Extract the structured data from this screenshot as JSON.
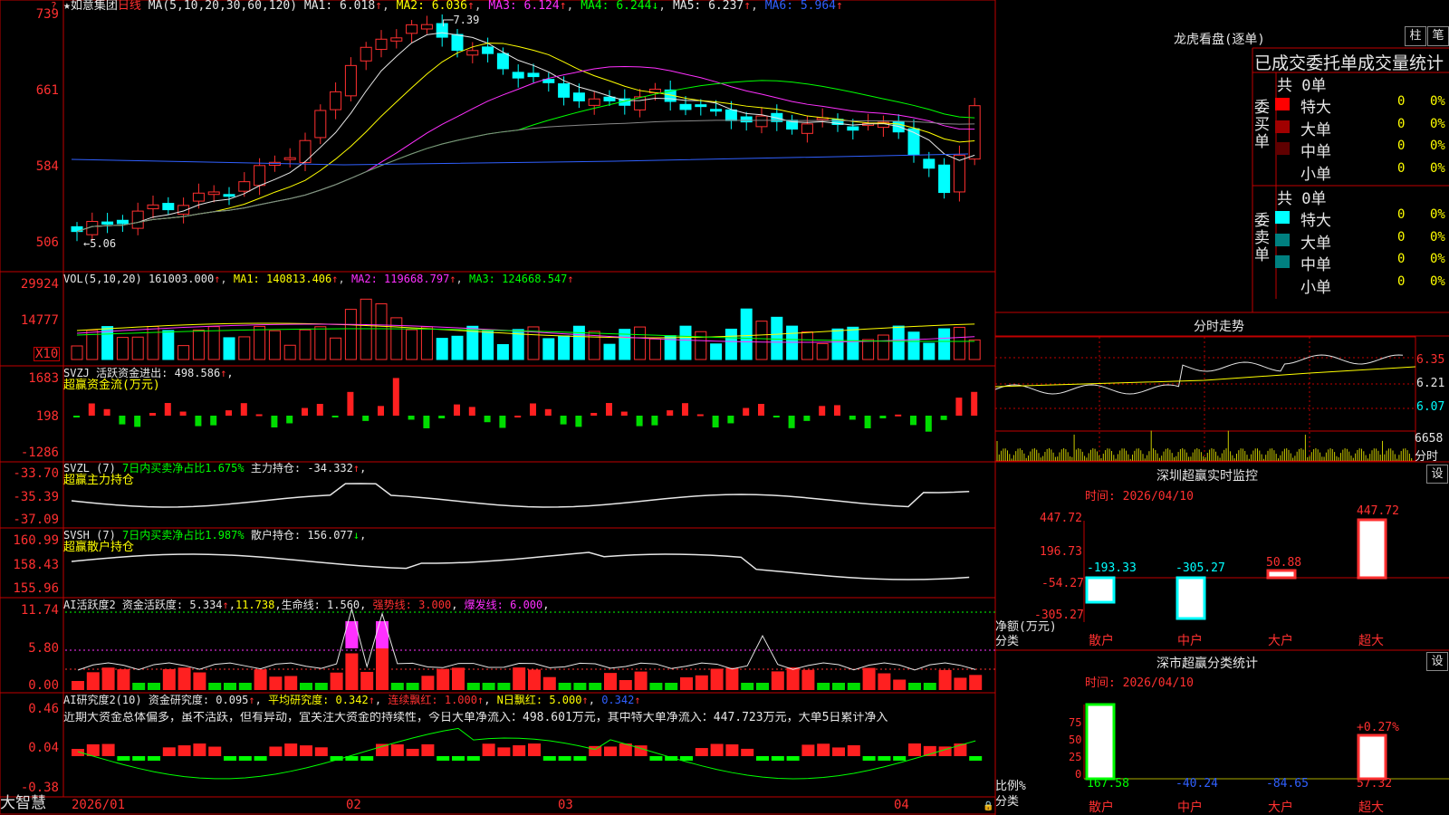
{
  "stock": {
    "star": "★",
    "name": "如意集团",
    "period": "日线"
  },
  "main": {
    "ma_params": "MA(5,10,20,30,60,120)",
    "ma_items": [
      {
        "label": "MA1:",
        "value": "6.018",
        "arrow": "↑",
        "color": "#e6e6e6"
      },
      {
        "label": "MA2:",
        "value": "6.036",
        "arrow": "↑",
        "color": "#ffff00"
      },
      {
        "label": "MA3:",
        "value": "6.124",
        "arrow": "↑",
        "color": "#ff30ff"
      },
      {
        "label": "MA4:",
        "value": "6.244",
        "arrow": "↓",
        "color": "#00ff00"
      },
      {
        "label": "MA5:",
        "value": "6.237",
        "arrow": "↑",
        "color": "#e6e6e6"
      },
      {
        "label": "MA6:",
        "value": "5.964",
        "arrow": "↑",
        "color": "#3060ff"
      }
    ],
    "yticks": [
      "739",
      "661",
      "584",
      "506"
    ],
    "high_label": "7.39",
    "low_label": "5.06",
    "info_icon": "?"
  },
  "vol": {
    "title": "VOL(5,10,20)",
    "value": "161003.000",
    "arrow": "↑",
    "ma1": "MA1: 140813.406",
    "ma1a": "↑",
    "ma2": "MA2: 119668.797",
    "ma2a": "↑",
    "ma3": "MA3: 124668.547",
    "ma3a": "↑",
    "yticks": [
      "29924",
      "14777"
    ],
    "unit": "X10"
  },
  "svzj": {
    "name": "SVZJ",
    "desc": "活跃资金进出:",
    "value": "498.586",
    "arrow": "↑",
    "sep": ",",
    "sub": "超赢资金流(万元)",
    "yticks": [
      "1683",
      "198",
      "-1286"
    ]
  },
  "svzl": {
    "name": "SVZL (7)",
    "desc": "7日内买卖净占比1.675%",
    "desc2": "主力持仓:",
    "value": "-34.332",
    "arrow": "↑",
    "sep": ",",
    "sub": "超赢主力持仓",
    "yticks": [
      "-33.70",
      "-35.39",
      "-37.09"
    ]
  },
  "svsh": {
    "name": "SVSH (7)",
    "desc": "7日内买卖净占比1.987%",
    "desc2": "散户持仓:",
    "value": "156.077",
    "arrow": "↓",
    "sep": ",",
    "sub": "超赢散户持仓",
    "yticks": [
      "160.99",
      "158.43",
      "155.96"
    ]
  },
  "ai1": {
    "name": "AI活跃度2",
    "desc": "资金活跃度:",
    "value": "5.334",
    "a1": "↑",
    "v2": "11.738",
    "lifeline": "生命线: 1.560",
    "strong": "强势线: 3.000",
    "burst": "爆发线: 6.000",
    "sep": ",",
    "yticks": [
      "11.74",
      "5.80",
      "0.00"
    ]
  },
  "ai2": {
    "name": "AI研究度2(10)",
    "desc": "资金研究度:",
    "value": "0.095",
    "a1": "↑",
    "avg": "平均研究度: 0.342",
    "a2": "↑",
    "cont": "连续飘红: 1.000",
    "a3": "↑",
    "nday": "N日飘红: 5.000",
    "a4": "↑",
    "last": "0.342",
    "a5": "↑",
    "sep": ",",
    "comment": "近期大资金总体偏多，虽不活跃，但有异动，宜关注大资金的持续性，今日大单净流入：498.601万元，其中特大单净流入：447.723万元，大单5日累计净入",
    "yticks": [
      "0.46",
      "0.04",
      "-0.38"
    ]
  },
  "xaxis": {
    "labels": [
      "2026/01",
      "02",
      "03",
      "04"
    ],
    "brand": "大智慧"
  },
  "dragon": {
    "title": "龙虎看盘(逐单)",
    "btn1": "柱",
    "btn2": "笔",
    "header": "已成交委托单成交量统计",
    "buy": {
      "side": "委买单",
      "total": "共 0单",
      "rows": [
        {
          "name": "特大",
          "v": "0",
          "p": "0%",
          "c": "#ff0000"
        },
        {
          "name": "大单",
          "v": "0",
          "p": "0%",
          "c": "#a00000"
        },
        {
          "name": "中单",
          "v": "0",
          "p": "0%",
          "c": "#600000"
        },
        {
          "name": "小单",
          "v": "0",
          "p": "0%",
          "c": ""
        }
      ]
    },
    "sell": {
      "side": "委卖单",
      "total": "共 0单",
      "rows": [
        {
          "name": "特大",
          "v": "0",
          "p": "0%",
          "c": "#00ffff"
        },
        {
          "name": "大单",
          "v": "0",
          "p": "0%",
          "c": "#008080"
        },
        {
          "name": "中单",
          "v": "0",
          "p": "0%",
          "c": "#008080"
        },
        {
          "name": "小单",
          "v": "0",
          "p": "0%",
          "c": ""
        }
      ]
    }
  },
  "intraday": {
    "title": "分时走势",
    "yticks": [
      "6.35",
      "6.21",
      "6.07"
    ],
    "vol": "6658",
    "vol_label": "分时"
  },
  "sz_monitor": {
    "title": "深圳超赢实时监控",
    "set": "设",
    "time": "时间: 2026/04/10",
    "yticks": [
      "447.72",
      "196.73",
      "-54.27",
      "-305.27"
    ],
    "bars": [
      {
        "cat": "散户",
        "val": "-193.33"
      },
      {
        "cat": "中户",
        "val": "-305.27"
      },
      {
        "cat": "大户",
        "val": "50.88"
      },
      {
        "cat": "超大",
        "val": "447.72"
      }
    ],
    "axis_label": "净额(万元)",
    "axis_label2": "分类"
  },
  "sz_class": {
    "title": "深市超赢分类统计",
    "set": "设",
    "time": "时间: 2026/04/10",
    "yticks": [
      "75",
      "50",
      "25",
      "0"
    ],
    "bars": [
      {
        "cat": "散户",
        "val": "167.58"
      },
      {
        "cat": "中户",
        "val": "-40.24"
      },
      {
        "cat": "大户",
        "val": "-84.65"
      },
      {
        "cat": "超大",
        "val": "57.32"
      }
    ],
    "extra": "+0.27%",
    "axis_label": "比例%",
    "axis_label2": "分类"
  },
  "colors": {
    "up": "#ff3030",
    "down": "#00ffff",
    "grid": "#c00000",
    "ma1": "#e6e6e6",
    "ma2": "#ffff00",
    "ma3": "#ff30ff",
    "ma4": "#00ff00",
    "ma6": "#3060ff"
  }
}
